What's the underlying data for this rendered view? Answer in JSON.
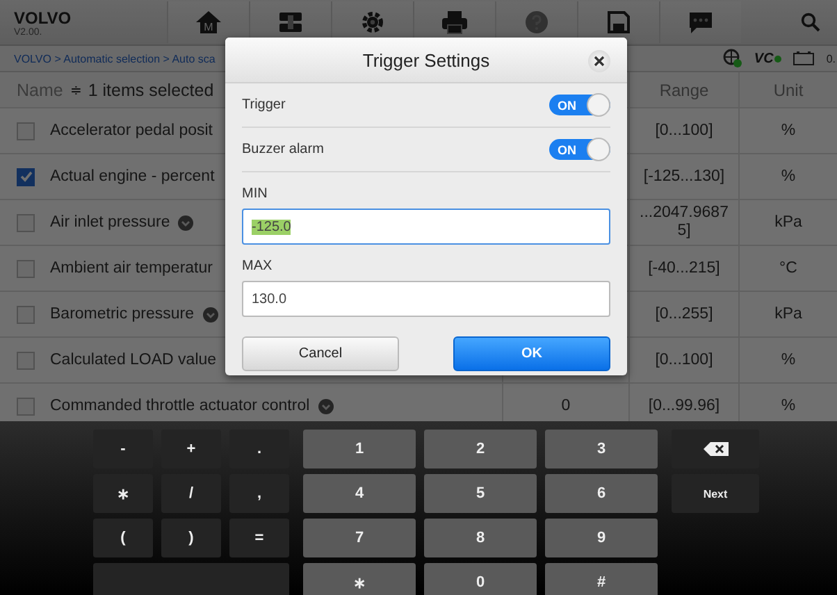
{
  "header": {
    "brand": "VOLVO",
    "version": "V2.00."
  },
  "toolbar": [
    {
      "kind": "home",
      "letter": "M"
    },
    {
      "kind": "vehicle"
    },
    {
      "kind": "gear"
    },
    {
      "kind": "printer"
    },
    {
      "kind": "help",
      "disabled": true
    },
    {
      "kind": "save"
    },
    {
      "kind": "chat"
    }
  ],
  "breadcrumb": "VOLVO > Automatic selection > Auto sca",
  "status": {
    "vci": "VC",
    "battery": "0."
  },
  "table": {
    "name_column": "Name",
    "sort_icon": "≑",
    "selection": "1 items selected",
    "columns": [
      "Range",
      "Unit"
    ],
    "rows": [
      {
        "name": "Accelerator pedal posit",
        "checked": false,
        "info": false,
        "range": "[0...100]",
        "unit": "%"
      },
      {
        "name": "Actual engine - percent",
        "checked": true,
        "info": false,
        "range": "[-125...130]",
        "unit": "%"
      },
      {
        "name": "Air inlet pressure",
        "checked": false,
        "info": true,
        "range": "...2047.96875]",
        "unit": "kPa"
      },
      {
        "name": "Ambient air temperatur",
        "checked": false,
        "info": false,
        "range": "[-40...215]",
        "unit": "°C"
      },
      {
        "name": "Barometric pressure",
        "checked": false,
        "info": true,
        "range": "[0...255]",
        "unit": "kPa"
      },
      {
        "name": "Calculated LOAD value",
        "checked": false,
        "info": false,
        "range": "[0...100]",
        "unit": "%"
      },
      {
        "name": "Commanded throttle actuator control",
        "checked": false,
        "info": true,
        "value": "0",
        "range": "[0...99.96]",
        "unit": "%"
      }
    ]
  },
  "dialog": {
    "title": "Trigger Settings",
    "toggles": [
      {
        "label": "Trigger",
        "on": true,
        "text": "ON"
      },
      {
        "label": "Buzzer alarm",
        "on": true,
        "text": "ON"
      }
    ],
    "fields": [
      {
        "label": "MIN",
        "value": "-125.0",
        "selected": true
      },
      {
        "label": "MAX",
        "value": "130.0",
        "selected": false
      }
    ],
    "buttons": [
      {
        "label": "Cancel",
        "kind": "secondary"
      },
      {
        "label": "OK",
        "kind": "primary"
      }
    ]
  },
  "keyboard": {
    "left": [
      {
        "label": "-"
      },
      {
        "label": "+"
      },
      {
        "label": "."
      },
      {
        "label": "∗"
      },
      {
        "label": "/"
      },
      {
        "label": ","
      },
      {
        "label": "("
      },
      {
        "label": ")"
      },
      {
        "label": "="
      },
      {
        "kind": "space"
      }
    ],
    "numbers": [
      "1",
      "2",
      "3",
      "4",
      "5",
      "6",
      "7",
      "8",
      "9",
      "∗",
      "0",
      "#"
    ],
    "right": [
      {
        "kind": "backspace"
      },
      {
        "kind": "next",
        "label": "Next"
      }
    ]
  }
}
